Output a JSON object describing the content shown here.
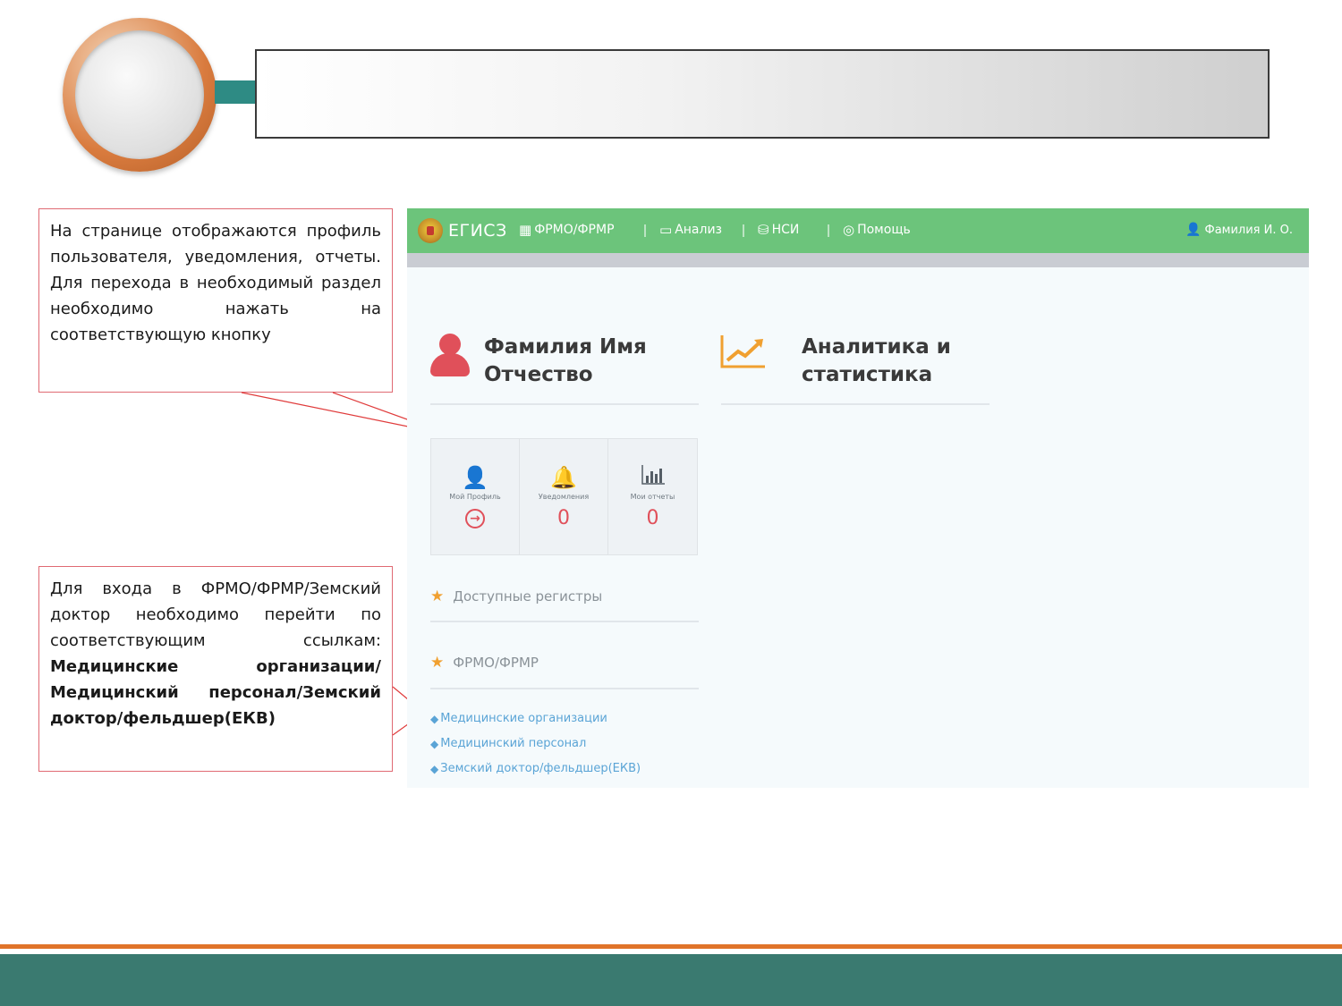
{
  "callouts": {
    "first_text": "На странице отображаются профиль пользователя, уведомления, отчеты. Для перехода в необходимый раздел необходимо нажать на соответствующую кнопку",
    "second_text": "Для входа в ФРМО/ФРМР/Земский доктор необходимо перейти по соответствующим ссылкам:",
    "second_bold": "Медицинские организации/Медицинский персонал/Земский доктор/фельдшер(ЕКВ)"
  },
  "app": {
    "brand": "ЕГИСЗ",
    "nav": {
      "frmo": "ФРМО/ФРМР",
      "analysis": "Анализ",
      "nsi": "НСИ",
      "help": "Помощь"
    },
    "user": "Фамилия И. О.",
    "profile_title": "Фамилия Имя Отчество",
    "analytics_title": "Аналитика и статистика",
    "tiles": [
      {
        "label": "Мой Профиль",
        "icon": "user-icon"
      },
      {
        "label": "Уведомления",
        "value": "0",
        "icon": "bell-icon"
      },
      {
        "label": "Мои отчеты",
        "value": "0",
        "icon": "bar-chart-icon"
      }
    ],
    "sections": {
      "registers": "Доступные регистры",
      "frmo": "ФРМО/ФРМР"
    },
    "links": [
      "Медицинские организации",
      "Медицинский персонал",
      "Земский доктор/фельдшер(ЕКВ)"
    ]
  },
  "colors": {
    "topbar": "#6cc47b",
    "accent_red": "#e0505a",
    "link_blue": "#5aa4d6",
    "footer_teal": "#3a7a70",
    "footer_orange": "#e0742a"
  }
}
